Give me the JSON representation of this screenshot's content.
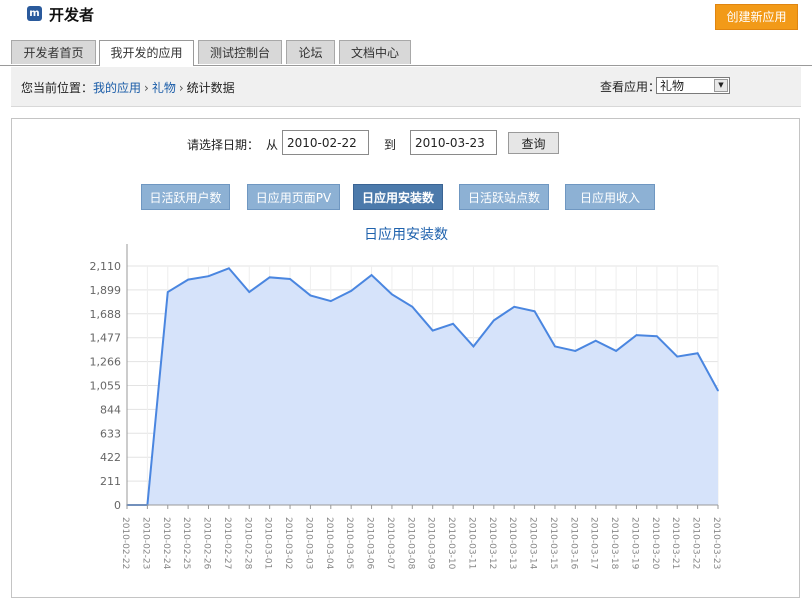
{
  "header": {
    "logo_glyph": "m",
    "title": "开发者",
    "create_button": "创建新应用"
  },
  "tabs": [
    {
      "label": "开发者首页",
      "active": false
    },
    {
      "label": "我开发的应用",
      "active": true
    },
    {
      "label": "测试控制台",
      "active": false
    },
    {
      "label": "论坛",
      "active": false
    },
    {
      "label": "文档中心",
      "active": false
    }
  ],
  "breadcrumb": {
    "prefix": "您当前位置：",
    "link1": "我的应用",
    "link2": "礼物",
    "current": "统计数据",
    "separator": "›"
  },
  "app_selector": {
    "label": "查看应用：",
    "value": "礼物",
    "arrow": "▼"
  },
  "date_filter": {
    "label": "请选择日期：",
    "from_label": "从",
    "from_value": "2010-02-22",
    "to_label": "到",
    "to_value": "2010-03-23",
    "query_button": "查询"
  },
  "metric_buttons": [
    {
      "label": "日活跃用户数",
      "active": false
    },
    {
      "label": "日应用页面PV",
      "active": false
    },
    {
      "label": "日应用安装数",
      "active": true
    },
    {
      "label": "日活跃站点数",
      "active": false
    },
    {
      "label": "日应用收入",
      "active": false
    }
  ],
  "colors": {
    "accent_orange": "#f29a18",
    "line": "#4a86e0",
    "area_fill": "#d6e3fa",
    "title_blue": "#1f62ad"
  },
  "chart_data": {
    "type": "area",
    "title": "日应用安装数",
    "y_ticks": [
      "0",
      "211",
      "422",
      "633",
      "844",
      "1,055",
      "1,266",
      "1,477",
      "1,688",
      "1,899",
      "2,110"
    ],
    "ylim": [
      0,
      2110
    ],
    "grid": true,
    "x": [
      "2010-02-22",
      "2010-02-23",
      "2010-02-24",
      "2010-02-25",
      "2010-02-26",
      "2010-02-27",
      "2010-02-28",
      "2010-03-01",
      "2010-03-02",
      "2010-03-03",
      "2010-03-04",
      "2010-03-05",
      "2010-03-06",
      "2010-03-07",
      "2010-03-08",
      "2010-03-09",
      "2010-03-10",
      "2010-03-11",
      "2010-03-12",
      "2010-03-13",
      "2010-03-14",
      "2010-03-15",
      "2010-03-16",
      "2010-03-17",
      "2010-03-18",
      "2010-03-19",
      "2010-03-20",
      "2010-03-21",
      "2010-03-22",
      "2010-03-23"
    ],
    "values": [
      0,
      0,
      1880,
      1990,
      2020,
      2090,
      1880,
      2010,
      1995,
      1850,
      1800,
      1890,
      2030,
      1860,
      1750,
      1540,
      1600,
      1400,
      1630,
      1750,
      1710,
      1400,
      1360,
      1450,
      1360,
      1500,
      1490,
      1310,
      1340,
      1010
    ]
  }
}
